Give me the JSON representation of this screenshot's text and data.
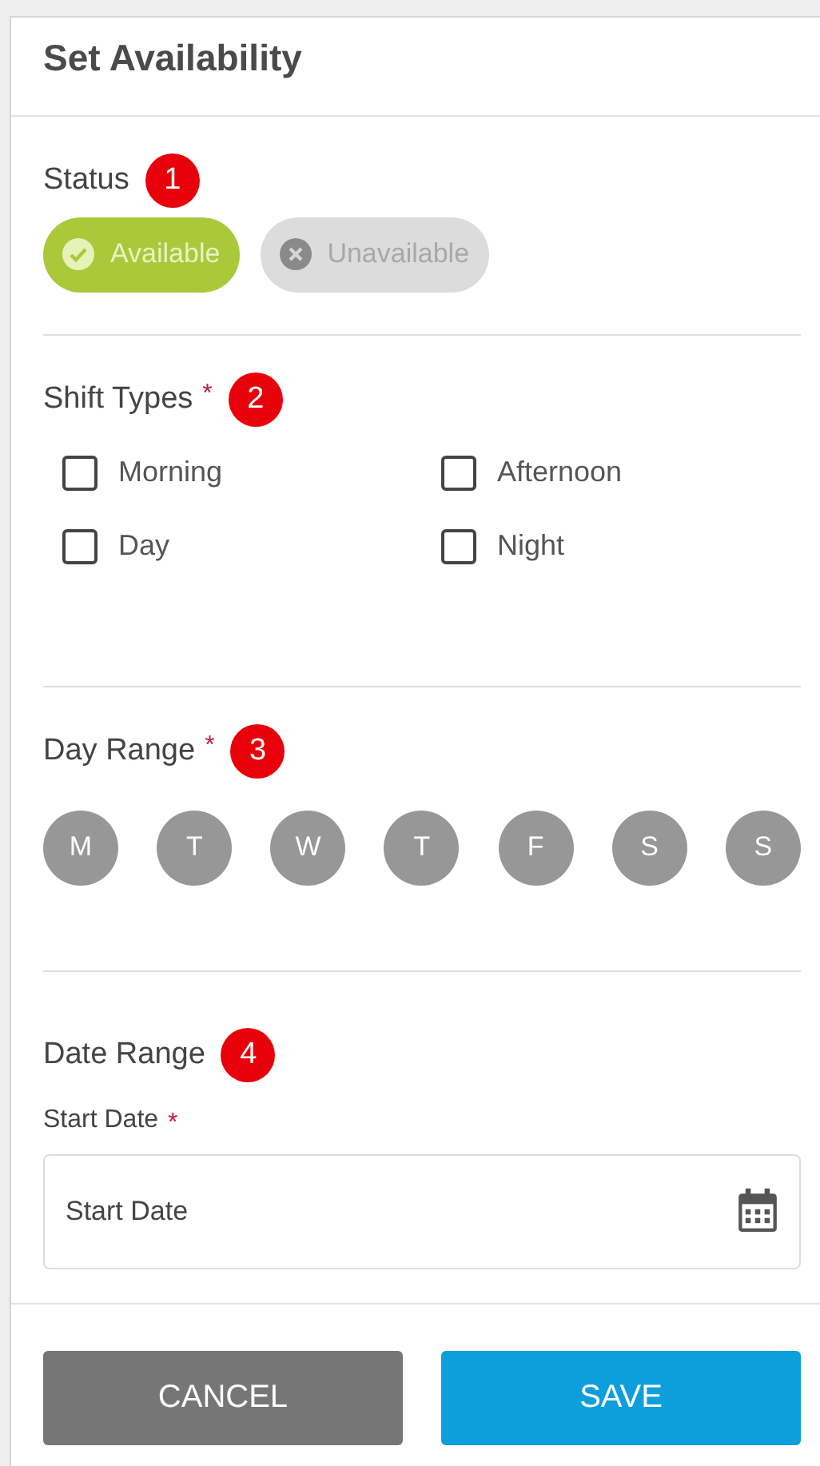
{
  "title": "Set Availability",
  "status": {
    "label": "Status",
    "badge": "1",
    "options": [
      {
        "label": "Available",
        "kind": "check",
        "selected": true
      },
      {
        "label": "Unavailable",
        "kind": "cross",
        "selected": false
      }
    ]
  },
  "shift_types": {
    "label": "Shift Types",
    "required_mark": "*",
    "badge": "2",
    "options": [
      {
        "label": "Morning",
        "checked": false
      },
      {
        "label": "Afternoon",
        "checked": false
      },
      {
        "label": "Day",
        "checked": false
      },
      {
        "label": "Night",
        "checked": false
      }
    ]
  },
  "day_range": {
    "label": "Day Range",
    "required_mark": "*",
    "badge": "3",
    "days": [
      {
        "label": "M",
        "selected": false
      },
      {
        "label": "T",
        "selected": false
      },
      {
        "label": "W",
        "selected": false
      },
      {
        "label": "T",
        "selected": false
      },
      {
        "label": "F",
        "selected": false
      },
      {
        "label": "S",
        "selected": false
      },
      {
        "label": "S",
        "selected": false
      }
    ]
  },
  "date_range": {
    "label": "Date Range",
    "badge": "4",
    "start_date": {
      "label": "Start Date",
      "required_mark": "*",
      "placeholder": "Start Date"
    }
  },
  "buttons": [
    {
      "label": "CANCEL",
      "kind": "secondary"
    },
    {
      "label": "SAVE",
      "kind": "primary"
    }
  ]
}
